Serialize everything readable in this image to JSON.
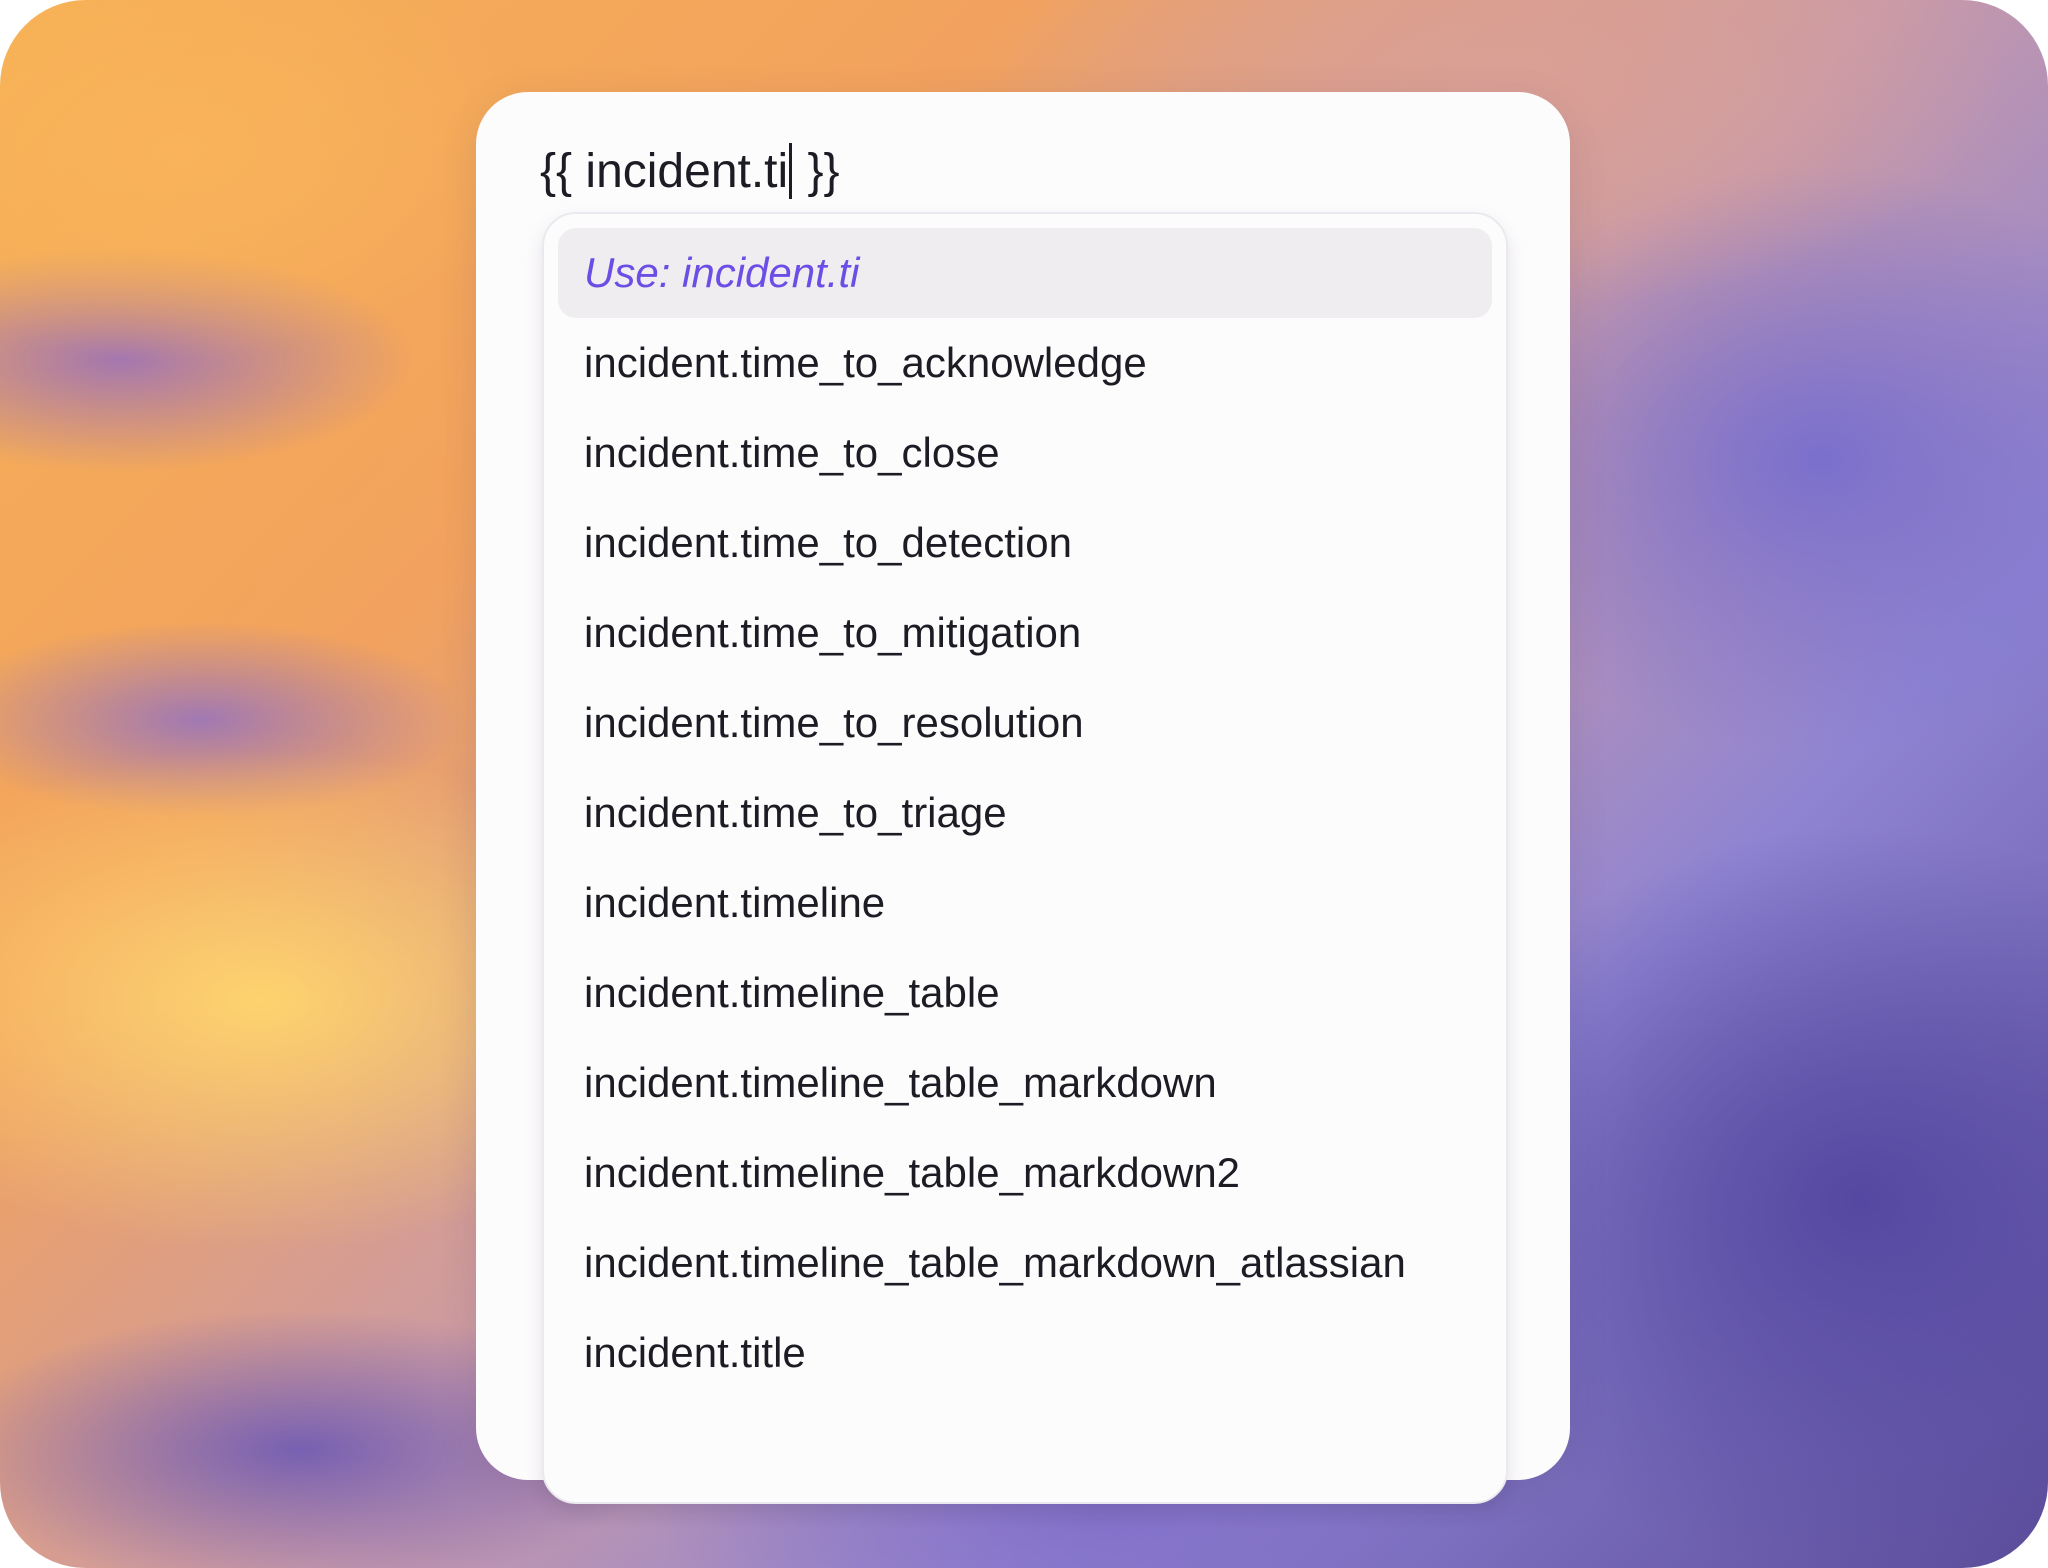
{
  "editor": {
    "prefix": "{{ incident.ti",
    "suffix": " }}"
  },
  "dropdown": {
    "use_option": "Use: incident.ti",
    "options": [
      "incident.time_to_acknowledge",
      "incident.time_to_close",
      "incident.time_to_detection",
      "incident.time_to_mitigation",
      "incident.time_to_resolution",
      "incident.time_to_triage",
      "incident.timeline",
      "incident.timeline_table",
      "incident.timeline_table_markdown",
      "incident.timeline_table_markdown2",
      "incident.timeline_table_markdown_atlassian",
      "incident.title"
    ]
  },
  "colors": {
    "accent": "#6b4ee6",
    "text": "#1d1c24",
    "highlight_bg": "#efedf0"
  }
}
